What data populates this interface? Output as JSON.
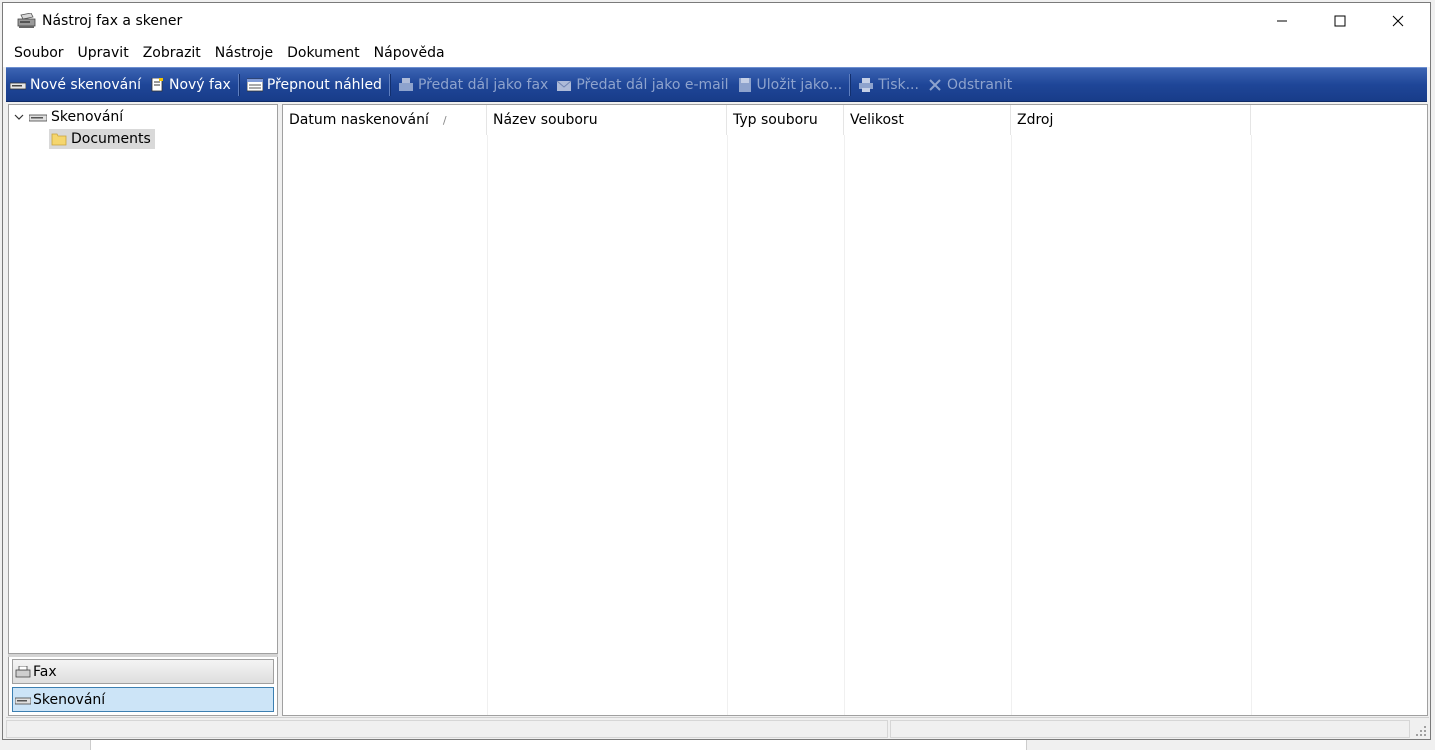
{
  "window": {
    "title": "Nástroj fax a skener",
    "icons": [
      "app-scanner-icon",
      "minimize-icon",
      "maximize-icon",
      "close-icon"
    ]
  },
  "menu": [
    "Soubor",
    "Upravit",
    "Zobrazit",
    "Nástroje",
    "Dokument",
    "Nápověda"
  ],
  "toolbar": {
    "new_scan": "Nové skenování",
    "new_fax": "Nový fax",
    "toggle_preview": "Přepnout náhled",
    "forward_fax": "Předat dál jako fax",
    "forward_email": "Předat dál jako e-mail",
    "save_as": "Uložit jako...",
    "print": "Tisk...",
    "delete": "Odstranit"
  },
  "tree": {
    "root_label": "Skenování",
    "child_label": "Documents",
    "expanded": true
  },
  "nav": {
    "fax_label": "Fax",
    "scan_label": "Skenování",
    "selected": "Skenování"
  },
  "columns": [
    "Datum naskenování",
    "Název souboru",
    "Typ souboru",
    "Velikost",
    "Zdroj"
  ],
  "colors": {
    "toolbar_top": "#3c64b3",
    "toolbar_bottom": "#183c89",
    "toolbar_disabled_text": "#8ea3cd",
    "selected_nav": "#cce4f7"
  }
}
